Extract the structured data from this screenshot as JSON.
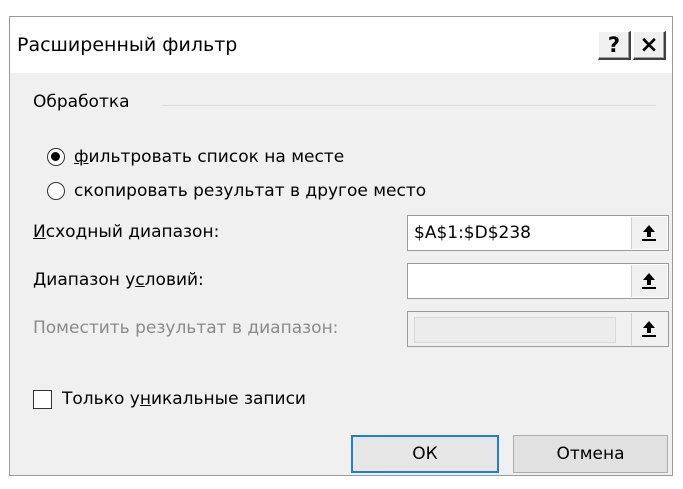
{
  "dialog": {
    "title": "Расширенный фильтр",
    "help_label": "?",
    "close_label": "×"
  },
  "processing": {
    "group_label": "Обработка",
    "options": [
      {
        "label_first": "ф",
        "label_rest": "ильтровать список на месте",
        "selected": true
      },
      {
        "label_first": "скопировать результат в ",
        "label_ul": "д",
        "label_rest": "ругое место",
        "selected": false
      }
    ]
  },
  "fields": {
    "list_range": {
      "label_ul": "И",
      "label_rest": "сходный диапазон:",
      "value": "$A$1:$D$238",
      "enabled": true
    },
    "criteria_range": {
      "label_pre": "Диапазон у",
      "label_ul": "с",
      "label_rest": "ловий:",
      "value": "",
      "enabled": true
    },
    "copy_to": {
      "label": "Поместить результат в диапазон:",
      "value": "",
      "enabled": false
    }
  },
  "unique": {
    "label_pre": "Только у",
    "label_ul": "н",
    "label_rest": "икальные записи",
    "checked": false
  },
  "buttons": {
    "ok": "ОК",
    "cancel": "Отмена"
  },
  "colors": {
    "dialog_bg": "#f0f0f0",
    "default_button_border": "#1f7ed6",
    "disabled_text": "#8a8a8a"
  },
  "icons": {
    "ref_button": "collapse-dialog-arrow-icon"
  }
}
